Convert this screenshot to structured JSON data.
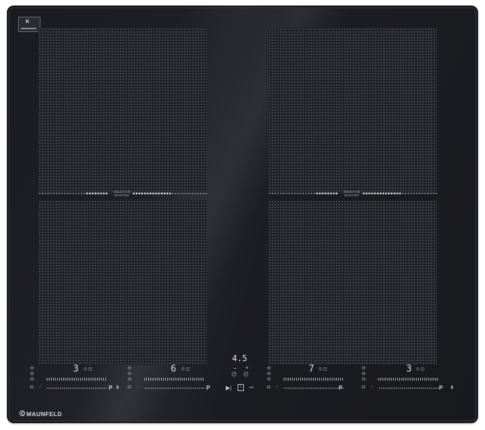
{
  "brand": {
    "name": "MAUNFELD"
  },
  "booster": {
    "label_line1": "INDUCTION",
    "label_line2": "BOOSTER"
  },
  "zones": [
    {
      "id": "front-left",
      "level": "3"
    },
    {
      "id": "rear-left",
      "level": "6"
    },
    {
      "id": "rear-right",
      "level": "7"
    },
    {
      "id": "front-right",
      "level": "3"
    }
  ],
  "timer": {
    "value": "4.5",
    "minus": "−",
    "plus": "+"
  },
  "power_boost_label": "P",
  "icons": {
    "power": "power-icon",
    "lock": "lock-icon",
    "key": "key-icon",
    "timer_minus": "timer-minus-icon",
    "timer_plus": "timer-plus-icon"
  },
  "colors": {
    "glass": "#1f2025",
    "text": "#dfe2e8"
  }
}
